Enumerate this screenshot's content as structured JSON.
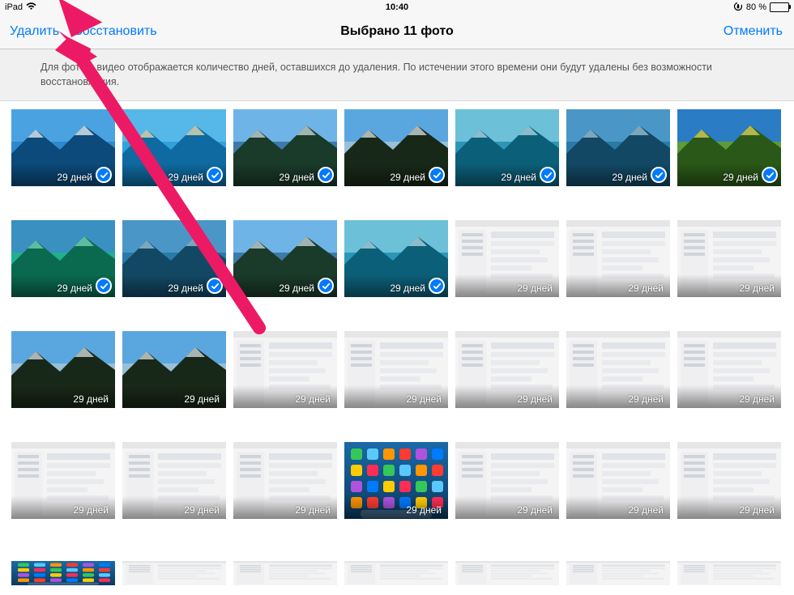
{
  "status": {
    "device": "iPad",
    "time": "10:40",
    "battery_pct": "80 %",
    "battery_fill": 80
  },
  "nav": {
    "delete": "Удалить",
    "restore": "Восстановить",
    "title": "Выбрано 11 фото",
    "cancel": "Отменить"
  },
  "banner": {
    "text": "Для фото и видео отображается количество дней, оставшихся до удаления. По истечении этого времени они будут удалены без возможности восстановления."
  },
  "days_label": "29 дней",
  "colors": {
    "accent": "#007aff",
    "arrow": "#ec1a64"
  },
  "thumbnails": [
    {
      "kind": "landscape",
      "sel": true,
      "tone": "sea"
    },
    {
      "kind": "landscape",
      "sel": true,
      "tone": "beach"
    },
    {
      "kind": "landscape",
      "sel": true,
      "tone": "mount"
    },
    {
      "kind": "landscape",
      "sel": true,
      "tone": "mount2"
    },
    {
      "kind": "landscape",
      "sel": true,
      "tone": "lake"
    },
    {
      "kind": "landscape",
      "sel": true,
      "tone": "lake2"
    },
    {
      "kind": "landscape",
      "sel": true,
      "tone": "tree"
    },
    {
      "kind": "landscape",
      "sel": true,
      "tone": "fall"
    },
    {
      "kind": "landscape",
      "sel": true,
      "tone": "lake2"
    },
    {
      "kind": "landscape",
      "sel": true,
      "tone": "mount"
    },
    {
      "kind": "landscape",
      "sel": true,
      "tone": "lake"
    },
    {
      "kind": "screenshot",
      "sel": false
    },
    {
      "kind": "screenshot",
      "sel": false
    },
    {
      "kind": "screenshot",
      "sel": false
    },
    {
      "kind": "landscape",
      "sel": false,
      "tone": "mount2"
    },
    {
      "kind": "landscape",
      "sel": false,
      "tone": "mount2"
    },
    {
      "kind": "screenshot",
      "sel": false
    },
    {
      "kind": "screenshot",
      "sel": false
    },
    {
      "kind": "screenshot",
      "sel": false
    },
    {
      "kind": "screenshot",
      "sel": false
    },
    {
      "kind": "screenshot",
      "sel": false
    },
    {
      "kind": "screenshot",
      "sel": false
    },
    {
      "kind": "screenshot",
      "sel": false
    },
    {
      "kind": "screenshot",
      "sel": false
    },
    {
      "kind": "homescreen",
      "sel": false
    },
    {
      "kind": "screenshot",
      "sel": false
    },
    {
      "kind": "screenshot",
      "sel": false
    },
    {
      "kind": "screenshot",
      "sel": false
    }
  ],
  "thumbnails_last": [
    {
      "kind": "homescreen"
    },
    {
      "kind": "screenshot"
    },
    {
      "kind": "screenshot"
    },
    {
      "kind": "screenshot"
    },
    {
      "kind": "screenshot"
    },
    {
      "kind": "screenshot"
    },
    {
      "kind": "screenshot"
    }
  ]
}
